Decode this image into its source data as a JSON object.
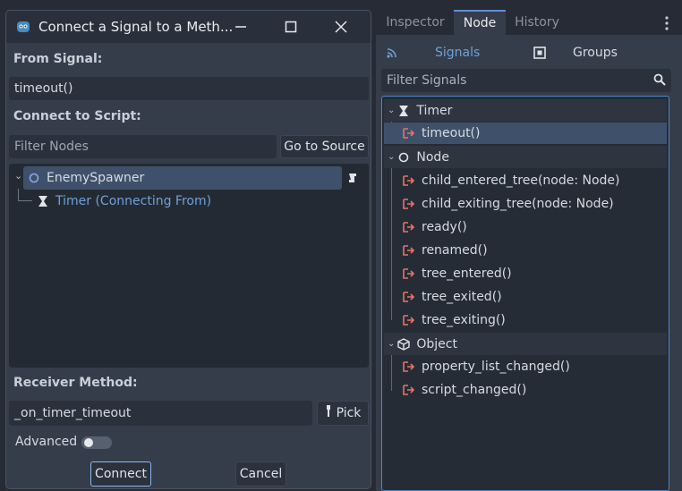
{
  "dialog": {
    "title": "Connect a Signal to a Meth...",
    "from_signal_label": "From Signal:",
    "from_signal_value": "timeout()",
    "connect_script_label": "Connect to Script:",
    "filter_nodes_placeholder": "Filter Nodes",
    "go_to_source": "Go to Source",
    "tree": [
      {
        "label": "EnemySpawner",
        "selected": true
      },
      {
        "label": "Timer (Connecting From)",
        "selected": false
      }
    ],
    "receiver_method_label": "Receiver Method:",
    "receiver_method_value": "_on_timer_timeout",
    "pick_label": "Pick",
    "advanced_label": "Advanced",
    "advanced_on": false,
    "connect_label": "Connect",
    "cancel_label": "Cancel"
  },
  "dock": {
    "tabs": [
      "Inspector",
      "Node",
      "History"
    ],
    "active_tab": "Node",
    "subtabs": {
      "signals": "Signals",
      "groups": "Groups"
    },
    "filter_placeholder": "Filter Signals",
    "categories": [
      {
        "name": "Timer",
        "icon": "hourglass-icon",
        "signals": [
          "timeout()"
        ]
      },
      {
        "name": "Node",
        "icon": "node-circle-icon",
        "signals": [
          "child_entered_tree(node: Node)",
          "child_exiting_tree(node: Node)",
          "ready()",
          "renamed()",
          "tree_entered()",
          "tree_exited()",
          "tree_exiting()"
        ]
      },
      {
        "name": "Object",
        "icon": "object-cube-icon",
        "signals": [
          "property_list_changed()",
          "script_changed()"
        ]
      }
    ]
  },
  "colors": {
    "accent": "#5c8fd1",
    "signal_icon": "#ec7164",
    "link_text": "#6ea0d8"
  }
}
